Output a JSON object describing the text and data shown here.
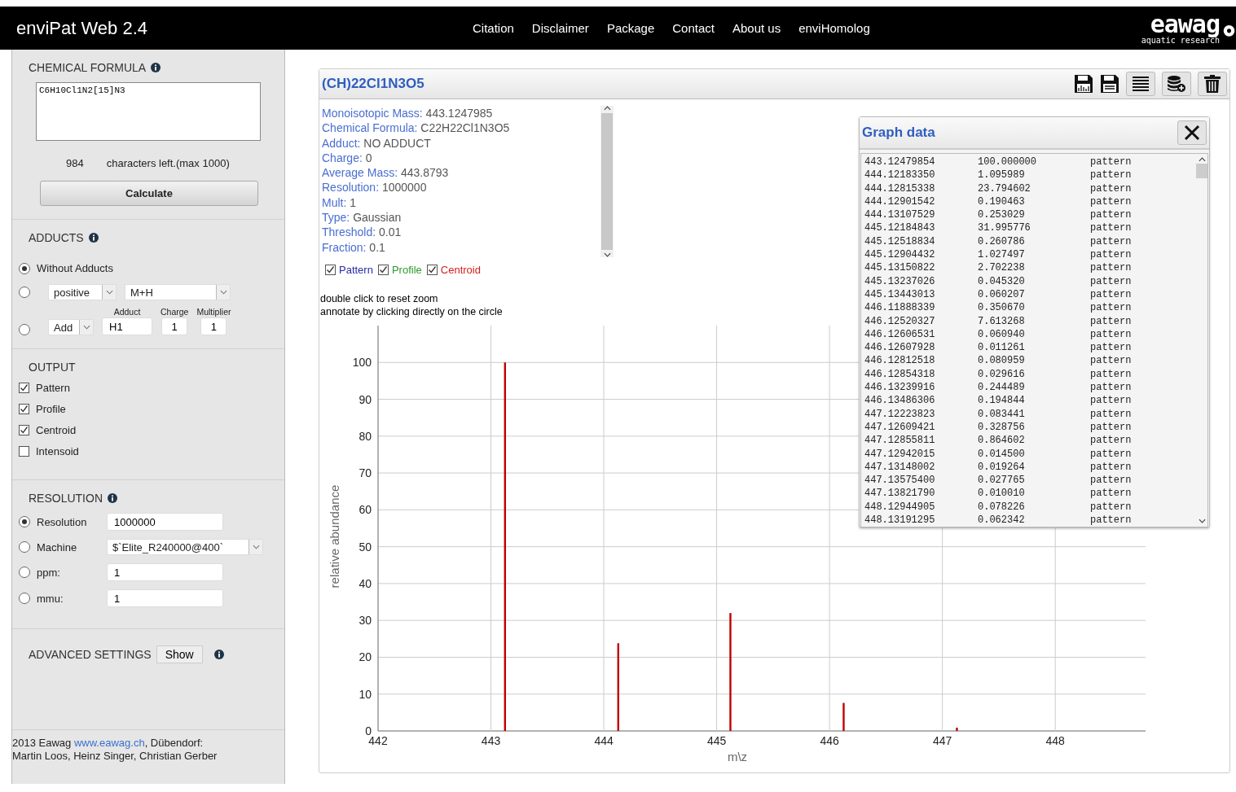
{
  "header": {
    "title": "enviPat Web 2.4",
    "nav": [
      {
        "label": "Citation"
      },
      {
        "label": "Disclaimer"
      },
      {
        "label": "Package"
      },
      {
        "label": "Contact"
      },
      {
        "label": "About us"
      },
      {
        "label": "enviHomolog"
      }
    ],
    "logo": {
      "name": "eawag",
      "tagline": "aquatic research"
    }
  },
  "sidebar": {
    "formula": {
      "heading": "CHEMICAL FORMULA",
      "value": "C6H10Cl1N2[15]N3",
      "chars_left": "984",
      "chars_left_label": "characters left.(max 1000)",
      "button": "Calculate"
    },
    "adducts": {
      "heading": "ADDUCTS",
      "options": [
        {
          "kind": "plain",
          "selected": true,
          "label": "Without Adducts"
        },
        {
          "kind": "preset",
          "selected": false,
          "mode": "positive",
          "adduct": "M+H"
        },
        {
          "kind": "custom",
          "selected": false,
          "operation": "Add",
          "adduct_label": "Adduct",
          "adduct": "H1",
          "charge_label": "Charge",
          "charge": "1",
          "multiplier_label": "Multiplier",
          "multiplier": "1"
        }
      ]
    },
    "output": {
      "heading": "OUTPUT",
      "items": [
        {
          "label": "Pattern",
          "checked": true
        },
        {
          "label": "Profile",
          "checked": true
        },
        {
          "label": "Centroid",
          "checked": true
        },
        {
          "label": "Intensoid",
          "checked": false
        }
      ]
    },
    "resolution": {
      "heading": "RESOLUTION",
      "options": [
        {
          "kind": "field",
          "label": "Resolution",
          "selected": true,
          "value": "1000000"
        },
        {
          "kind": "select",
          "label": "Machine",
          "selected": false,
          "value": "$`Elite_R240000@400`"
        },
        {
          "kind": "field",
          "label": "ppm:",
          "selected": false,
          "value": "1"
        },
        {
          "kind": "field",
          "label": "mmu:",
          "selected": false,
          "value": "1"
        }
      ]
    },
    "advanced": {
      "heading": "ADVANCED SETTINGS",
      "button": "Show"
    },
    "footer": {
      "prefix": "2013 Eawag ",
      "link": "www.eawag.ch",
      "suffix": ", Dübendorf:",
      "authors": "Martin Loos, Heinz Singer, Christian Gerber"
    }
  },
  "result": {
    "title": "(CH)22Cl1N3O5",
    "info": [
      {
        "label": "Monoisotopic Mass:",
        "value": "443.1247985"
      },
      {
        "label": "Chemical Formula:",
        "value": "C22H22Cl1N3O5"
      },
      {
        "label": "Adduct:",
        "value": "NO ADDUCT"
      },
      {
        "label": "Charge:",
        "value": "0"
      },
      {
        "label": "Average Mass:",
        "value": "443.8793"
      },
      {
        "label": "Resolution:",
        "value": "1000000"
      },
      {
        "label": "Mult:",
        "value": "1"
      },
      {
        "label": "Type:",
        "value": "Gaussian"
      },
      {
        "label": "Threshold:",
        "value": "0.01"
      },
      {
        "label": "Fraction:",
        "value": "0.1"
      }
    ],
    "legend": [
      {
        "label": "Pattern",
        "checked": true,
        "color": "#2a2aa8"
      },
      {
        "label": "Profile",
        "checked": true,
        "color": "#2e9a2e"
      },
      {
        "label": "Centroid",
        "checked": true,
        "color": "#d42020"
      }
    ],
    "notes": [
      "double click to reset zoom",
      "annotate by clicking directly on the circle"
    ],
    "chart_data": {
      "type": "bar",
      "xlabel": "m\\z",
      "ylabel": "relative abundance",
      "x": [
        443.12479854,
        444.12815338,
        445.12184843,
        446.12520327,
        447.12855811
      ],
      "values": [
        100,
        23.8,
        32,
        7.6,
        0.9
      ],
      "grid": true,
      "xlim": [
        442,
        448.8
      ],
      "ylim": [
        0,
        110
      ],
      "xticks": [
        442,
        443,
        444,
        445,
        446,
        447,
        448
      ],
      "yticks": [
        0,
        10,
        20,
        30,
        40,
        50,
        60,
        70,
        80,
        90,
        100
      ]
    },
    "graph_data": {
      "title": "Graph data",
      "rows": [
        [
          "443.12479854",
          "100.000000",
          "pattern"
        ],
        [
          "444.12183350",
          "1.095989",
          "pattern"
        ],
        [
          "444.12815338",
          "23.794602",
          "pattern"
        ],
        [
          "444.12901542",
          "0.190463",
          "pattern"
        ],
        [
          "444.13107529",
          "0.253029",
          "pattern"
        ],
        [
          "445.12184843",
          "31.995776",
          "pattern"
        ],
        [
          "445.12518834",
          "0.260786",
          "pattern"
        ],
        [
          "445.12904432",
          "1.027497",
          "pattern"
        ],
        [
          "445.13150822",
          "2.702238",
          "pattern"
        ],
        [
          "445.13237026",
          "0.045320",
          "pattern"
        ],
        [
          "445.13443013",
          "0.060207",
          "pattern"
        ],
        [
          "446.11888339",
          "0.350670",
          "pattern"
        ],
        [
          "446.12520327",
          "7.613268",
          "pattern"
        ],
        [
          "446.12606531",
          "0.060940",
          "pattern"
        ],
        [
          "446.12607928",
          "0.011261",
          "pattern"
        ],
        [
          "446.12812518",
          "0.080959",
          "pattern"
        ],
        [
          "446.12854318",
          "0.029616",
          "pattern"
        ],
        [
          "446.13239916",
          "0.244489",
          "pattern"
        ],
        [
          "446.13486306",
          "0.194844",
          "pattern"
        ],
        [
          "447.12223823",
          "0.083441",
          "pattern"
        ],
        [
          "447.12609421",
          "0.328756",
          "pattern"
        ],
        [
          "447.12855811",
          "0.864602",
          "pattern"
        ],
        [
          "447.12942015",
          "0.014500",
          "pattern"
        ],
        [
          "447.13148002",
          "0.019264",
          "pattern"
        ],
        [
          "447.13575400",
          "0.027765",
          "pattern"
        ],
        [
          "447.13821790",
          "0.010010",
          "pattern"
        ],
        [
          "448.12944905",
          "0.078226",
          "pattern"
        ],
        [
          "448.13191295",
          "0.062342",
          "pattern"
        ]
      ]
    }
  }
}
